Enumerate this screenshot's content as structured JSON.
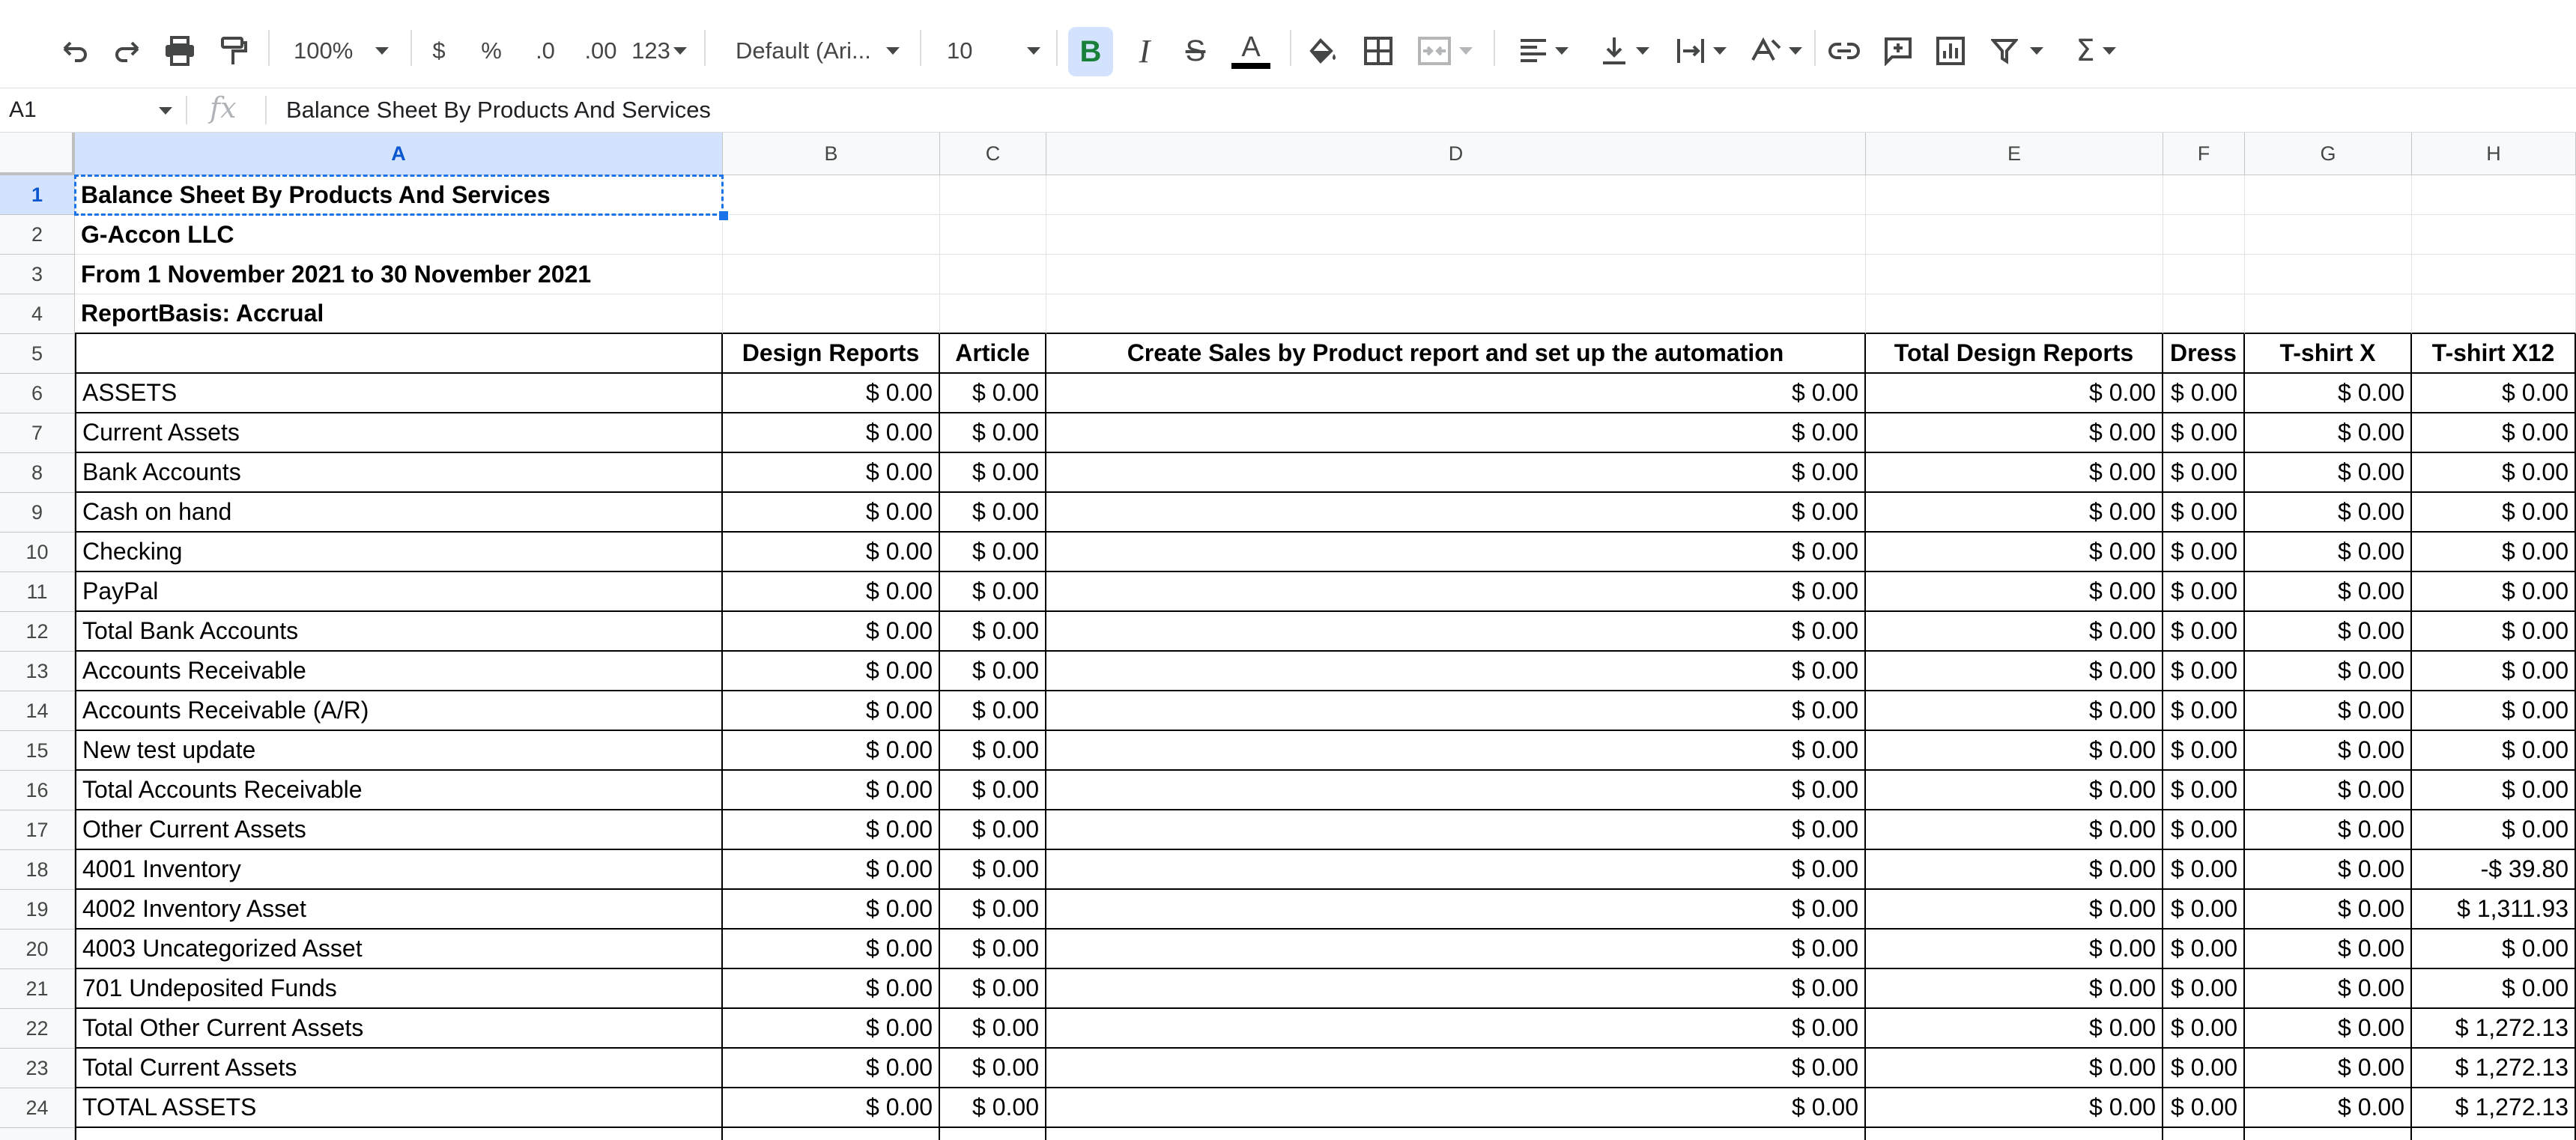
{
  "toolbar": {
    "zoom": "100%",
    "currency": "$",
    "percent": "%",
    "decrease_decimal": ".0",
    "increase_decimal": ".00",
    "more_formats": "123",
    "font_family": "Default (Ari...",
    "font_size": "10",
    "icons": [
      "undo-icon",
      "redo-icon",
      "print-icon",
      "paint-format-icon",
      "bold-icon",
      "italic-icon",
      "strikethrough-icon",
      "text-color-icon",
      "fill-color-icon",
      "borders-icon",
      "merge-cells-icon",
      "horizontal-align-icon",
      "vertical-align-icon",
      "text-wrap-icon",
      "text-rotation-icon",
      "link-icon",
      "comment-icon",
      "chart-icon",
      "filter-icon",
      "functions-icon"
    ],
    "accent_active": "#d3e3fd",
    "bold_color": "#188038"
  },
  "formula_bar": {
    "name_box": "A1",
    "fx_symbol": "fx",
    "content": "Balance Sheet By Products And Services"
  },
  "grid": {
    "columns": [
      "A",
      "B",
      "C",
      "D",
      "E",
      "F",
      "G",
      "H"
    ],
    "row_numbers": [
      "1",
      "2",
      "3",
      "4",
      "5",
      "6",
      "7",
      "8",
      "9",
      "10",
      "11",
      "12",
      "13",
      "14",
      "15",
      "16",
      "17",
      "18",
      "19",
      "20",
      "21",
      "22",
      "23",
      "24"
    ],
    "title_rows": [
      "Balance Sheet By Products And Services",
      "G-Accon LLC",
      "From 1 November 2021 to 30 November 2021",
      "ReportBasis: Accrual"
    ],
    "header_row": [
      "",
      "Design Reports",
      "Article",
      "Create Sales by Product report and set up the automation",
      "Total Design Reports",
      "Dress",
      "T-shirt X",
      "T-shirt X12"
    ],
    "rows": [
      {
        "label": "ASSETS",
        "values": [
          "$ 0.00",
          "$ 0.00",
          "$ 0.00",
          "$ 0.00",
          "$ 0.00",
          "$ 0.00",
          "$ 0.00"
        ]
      },
      {
        "label": "Current Assets",
        "values": [
          "$ 0.00",
          "$ 0.00",
          "$ 0.00",
          "$ 0.00",
          "$ 0.00",
          "$ 0.00",
          "$ 0.00"
        ]
      },
      {
        "label": "Bank Accounts",
        "values": [
          "$ 0.00",
          "$ 0.00",
          "$ 0.00",
          "$ 0.00",
          "$ 0.00",
          "$ 0.00",
          "$ 0.00"
        ]
      },
      {
        "label": "Cash on hand",
        "values": [
          "$ 0.00",
          "$ 0.00",
          "$ 0.00",
          "$ 0.00",
          "$ 0.00",
          "$ 0.00",
          "$ 0.00"
        ]
      },
      {
        "label": "Checking",
        "values": [
          "$ 0.00",
          "$ 0.00",
          "$ 0.00",
          "$ 0.00",
          "$ 0.00",
          "$ 0.00",
          "$ 0.00"
        ]
      },
      {
        "label": "PayPal",
        "values": [
          "$ 0.00",
          "$ 0.00",
          "$ 0.00",
          "$ 0.00",
          "$ 0.00",
          "$ 0.00",
          "$ 0.00"
        ]
      },
      {
        "label": "Total Bank Accounts",
        "values": [
          "$ 0.00",
          "$ 0.00",
          "$ 0.00",
          "$ 0.00",
          "$ 0.00",
          "$ 0.00",
          "$ 0.00"
        ]
      },
      {
        "label": "Accounts Receivable",
        "values": [
          "$ 0.00",
          "$ 0.00",
          "$ 0.00",
          "$ 0.00",
          "$ 0.00",
          "$ 0.00",
          "$ 0.00"
        ]
      },
      {
        "label": "Accounts Receivable (A/R)",
        "values": [
          "$ 0.00",
          "$ 0.00",
          "$ 0.00",
          "$ 0.00",
          "$ 0.00",
          "$ 0.00",
          "$ 0.00"
        ]
      },
      {
        "label": "New test update",
        "values": [
          "$ 0.00",
          "$ 0.00",
          "$ 0.00",
          "$ 0.00",
          "$ 0.00",
          "$ 0.00",
          "$ 0.00"
        ]
      },
      {
        "label": "Total Accounts Receivable",
        "values": [
          "$ 0.00",
          "$ 0.00",
          "$ 0.00",
          "$ 0.00",
          "$ 0.00",
          "$ 0.00",
          "$ 0.00"
        ]
      },
      {
        "label": "Other Current Assets",
        "values": [
          "$ 0.00",
          "$ 0.00",
          "$ 0.00",
          "$ 0.00",
          "$ 0.00",
          "$ 0.00",
          "$ 0.00"
        ]
      },
      {
        "label": "4001 Inventory",
        "values": [
          "$ 0.00",
          "$ 0.00",
          "$ 0.00",
          "$ 0.00",
          "$ 0.00",
          "$ 0.00",
          "-$ 39.80"
        ]
      },
      {
        "label": "4002 Inventory Asset",
        "values": [
          "$ 0.00",
          "$ 0.00",
          "$ 0.00",
          "$ 0.00",
          "$ 0.00",
          "$ 0.00",
          "$ 1,311.93"
        ]
      },
      {
        "label": "4003 Uncategorized Asset",
        "values": [
          "$ 0.00",
          "$ 0.00",
          "$ 0.00",
          "$ 0.00",
          "$ 0.00",
          "$ 0.00",
          "$ 0.00"
        ]
      },
      {
        "label": "701 Undeposited Funds",
        "values": [
          "$ 0.00",
          "$ 0.00",
          "$ 0.00",
          "$ 0.00",
          "$ 0.00",
          "$ 0.00",
          "$ 0.00"
        ]
      },
      {
        "label": "Total Other Current Assets",
        "values": [
          "$ 0.00",
          "$ 0.00",
          "$ 0.00",
          "$ 0.00",
          "$ 0.00",
          "$ 0.00",
          "$ 1,272.13"
        ]
      },
      {
        "label": "Total Current Assets",
        "values": [
          "$ 0.00",
          "$ 0.00",
          "$ 0.00",
          "$ 0.00",
          "$ 0.00",
          "$ 0.00",
          "$ 1,272.13"
        ]
      },
      {
        "label": "TOTAL ASSETS",
        "values": [
          "$ 0.00",
          "$ 0.00",
          "$ 0.00",
          "$ 0.00",
          "$ 0.00",
          "$ 0.00",
          "$ 1,272.13"
        ]
      }
    ]
  }
}
